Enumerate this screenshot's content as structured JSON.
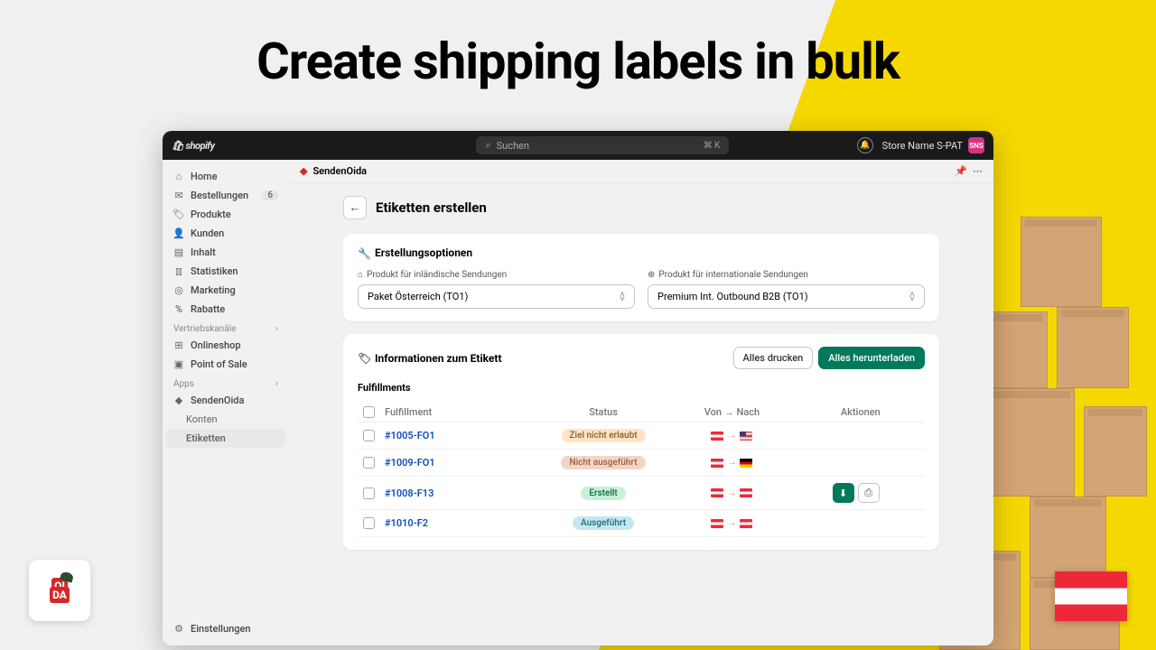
{
  "hero_title": "Create shipping labels in bulk",
  "topbar": {
    "logo": "shopify",
    "search_placeholder": "Suchen",
    "search_shortcut": "⌘ K",
    "store_name": "Store Name S-PAT",
    "avatar_initials": "SNS"
  },
  "sidebar": {
    "main": [
      {
        "icon": "home",
        "label": "Home"
      },
      {
        "icon": "orders",
        "label": "Bestellungen",
        "badge": "6"
      },
      {
        "icon": "products",
        "label": "Produkte"
      },
      {
        "icon": "customers",
        "label": "Kunden"
      },
      {
        "icon": "content",
        "label": "Inhalt"
      },
      {
        "icon": "analytics",
        "label": "Statistiken"
      },
      {
        "icon": "marketing",
        "label": "Marketing"
      },
      {
        "icon": "discounts",
        "label": "Rabatte"
      }
    ],
    "channels_header": "Vertriebskanäle",
    "channels": [
      {
        "icon": "store",
        "label": "Onlineshop"
      },
      {
        "icon": "pos",
        "label": "Point of Sale"
      }
    ],
    "apps_header": "Apps",
    "apps": [
      {
        "icon": "app",
        "label": "SendenOida"
      },
      {
        "label": "Konten",
        "sub": true
      },
      {
        "label": "Etiketten",
        "sub": true,
        "active": true
      }
    ],
    "settings": "Einstellungen"
  },
  "content": {
    "app_name": "SendenOida",
    "page_title": "Etiketten erstellen",
    "options_title": "Erstellungsoptionen",
    "domestic_label": "Produkt für inländische Sendungen",
    "domestic_value": "Paket Österreich (TO1)",
    "intl_label": "Produkt für internationale Sendungen",
    "intl_value": "Premium Int. Outbound B2B (TO1)",
    "info_title": "Informationen zum Etikett",
    "print_all": "Alles drucken",
    "download_all": "Alles herunterladen",
    "fulfillments_title": "Fulfillments",
    "table": {
      "headers": {
        "fulfillment": "Fulfillment",
        "status": "Status",
        "route": "Von → Nach",
        "actions": "Aktionen"
      },
      "rows": [
        {
          "id": "#1005-FO1",
          "status": "Ziel nicht erlaubt",
          "status_class": "status-warn",
          "from": "at",
          "to": "us",
          "actions": false
        },
        {
          "id": "#1009-FO1",
          "status": "Nicht ausgeführt",
          "status_class": "status-neutral",
          "from": "at",
          "to": "de",
          "actions": false
        },
        {
          "id": "#1008-F13",
          "status": "Erstellt",
          "status_class": "status-created",
          "from": "at",
          "to": "at",
          "actions": true
        },
        {
          "id": "#1010-F2",
          "status": "Ausgeführt",
          "status_class": "status-done",
          "from": "at",
          "to": "at",
          "actions": false
        }
      ]
    }
  }
}
